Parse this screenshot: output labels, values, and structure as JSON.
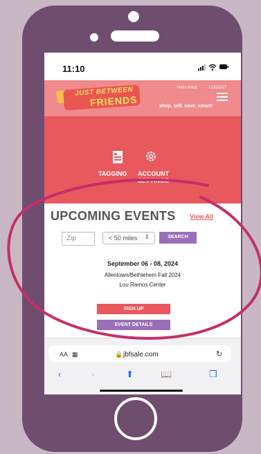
{
  "status_bar": {
    "time": "11:10",
    "icons": "…◠ ▬"
  },
  "header": {
    "logo_line1": "JUST BETWEEN",
    "logo_line2": "FRIENDS",
    "hello": "Hello Kristi",
    "logout": "LOGOUT",
    "tagline": "shop. sell. save. smart!"
  },
  "menu": {
    "tagging_label": "TAGGING",
    "account_label_line1": "ACCOUNT",
    "account_label_line2": "SETTINGS"
  },
  "events": {
    "title": "UPCOMING EVENTS",
    "view_all": "View All",
    "zip_placeholder": "Zip",
    "distance_value": "< 50 miles",
    "search_label": "SEARCH",
    "event": {
      "date": "September 06 - 08, 2024",
      "name": "Allentown/Bethlehem Fall 2024",
      "venue": "Lou Ramos Center",
      "signup_label": "SIGN UP",
      "details_label": "EVENT DETAILS"
    }
  },
  "browser": {
    "aa_label": "AA",
    "url": "jbfsale.com",
    "reload_icon": "reload-icon",
    "back_icon": "back-icon",
    "forward_icon": "forward-icon",
    "share_icon": "share-icon",
    "bookmarks_icon": "bookmarks-icon",
    "tabs_icon": "tabs-icon"
  },
  "colors": {
    "background": "#c9b7c6",
    "phone": "#6f4d6e",
    "coral": "#e8585d",
    "purple": "#9b6fb8",
    "highlight_circle": "#c42f6a"
  }
}
